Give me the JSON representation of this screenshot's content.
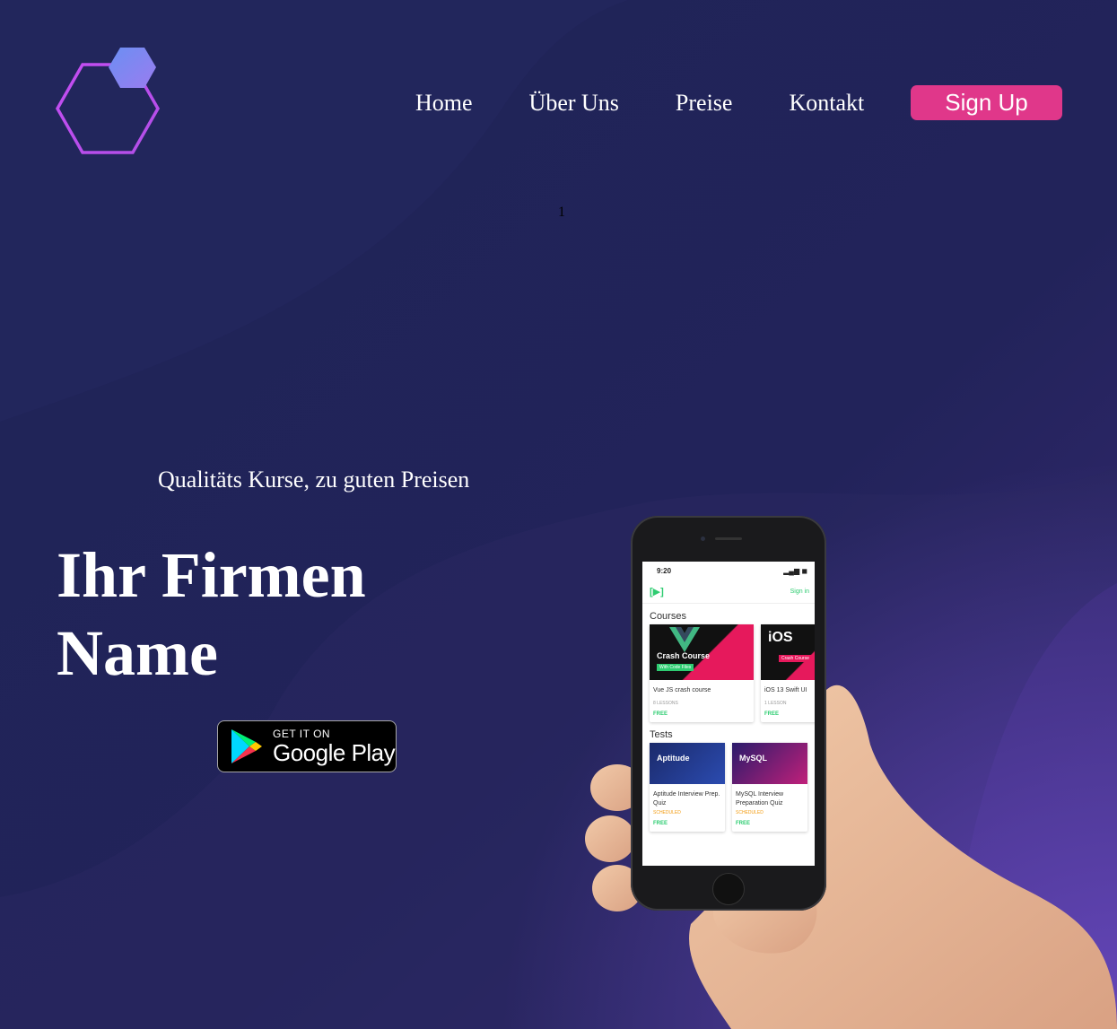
{
  "nav": {
    "items": [
      {
        "label": "Home"
      },
      {
        "label": "Über Uns"
      },
      {
        "label": "Preise"
      },
      {
        "label": "Kontakt"
      }
    ],
    "signup_label": "Sign Up"
  },
  "counter": "1",
  "hero": {
    "tagline": "Qualitäts Kurse, zu guten Preisen",
    "title": "Ihr Firmen Name"
  },
  "store_badge": {
    "small": "GET IT ON",
    "big": "Google Play"
  },
  "phone_screen": {
    "time": "9:20",
    "signin": "Sign in",
    "courses_title": "Courses",
    "courses": [
      {
        "thumb_title": "Crash Course",
        "thumb_sub": "With Code Files",
        "name": "Vue JS crash course",
        "meta": "8 LESSONS",
        "price": "FREE"
      },
      {
        "thumb_title": "iOS",
        "thumb_sub": "Crash Course",
        "name": "iOS 13 Swift UI",
        "meta": "1 LESSON",
        "price": "FREE"
      }
    ],
    "tests_title": "Tests",
    "tests": [
      {
        "thumb_title": "Aptitude",
        "name": "Aptitude Interview Prep. Quiz",
        "status": "SCHEDULED",
        "price": "FREE"
      },
      {
        "thumb_title": "MySQL",
        "name": "MySQL Interview Preparation Quiz",
        "status": "SCHEDULED",
        "price": "FREE"
      }
    ]
  },
  "colors": {
    "background": "#1f2356",
    "accent": "#e0378a",
    "logo_gradient_start": "#6a8df0",
    "logo_gradient_end": "#c04ef0",
    "corner_glow": "#6f4fd0"
  },
  "icons": {
    "logo": "hexagon-logo-icon",
    "play": "google-play-triangle-icon"
  }
}
